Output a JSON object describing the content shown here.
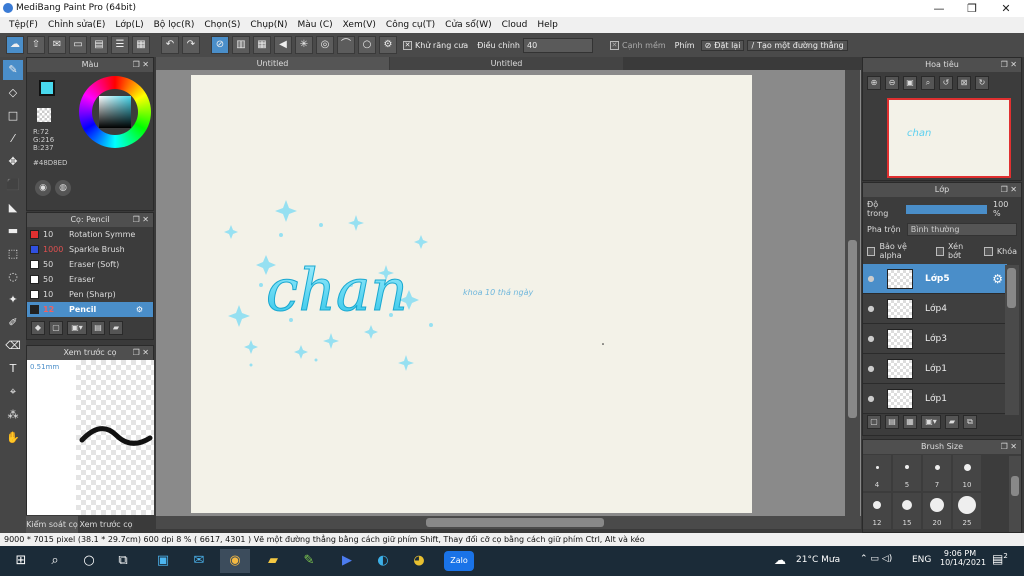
{
  "window": {
    "title": "MediBang Paint Pro (64bit)",
    "min": "—",
    "max": "❐",
    "close": "✕"
  },
  "menu": [
    "Tệp(F)",
    "Chỉnh sửa(E)",
    "Lớp(L)",
    "Bộ lọc(R)",
    "Chọn(S)",
    "Chụp(N)",
    "Màu (C)",
    "Xem(V)",
    "Công cụ(T)",
    "Cửa sổ(W)",
    "Cloud",
    "Help"
  ],
  "toolbar": {
    "antialias_label": "Khử răng cưa",
    "adjust_label": "Điều chỉnh",
    "adjust_value": "40",
    "edge_label": "Cạnh mềm",
    "key_label": "Phím",
    "set_label": "Đặt lại",
    "straight_label": "Tạo một đường thẳng"
  },
  "tabs": [
    "Untitled",
    "Untitled"
  ],
  "color_panel": {
    "title": "Màu",
    "r": "R:72",
    "g": "G:216",
    "b": "B:237",
    "hex": "#48D8ED",
    "primary": "#48D8ED",
    "secondary": "#FF0000"
  },
  "brush_panel": {
    "title": "Cọ: Pencil",
    "items": [
      {
        "size": "10",
        "name": "Rotation Symme",
        "color": "#e03030"
      },
      {
        "size": "1000",
        "name": "Sparkle Brush",
        "color": "#3050e0"
      },
      {
        "size": "50",
        "name": "Eraser (Soft)",
        "color": "#ffffff"
      },
      {
        "size": "50",
        "name": "Eraser",
        "color": "#ffffff"
      },
      {
        "size": "10",
        "name": "Pen (Sharp)",
        "color": "#ffffff"
      },
      {
        "size": "12",
        "name": "Pencil",
        "color": "#222222"
      }
    ]
  },
  "preview_panel": {
    "title": "Xem trước cọ",
    "size": "0.51mm"
  },
  "bottom_tabs": [
    "Kiểm soát cọ",
    "Xem trước cọ"
  ],
  "canvas_art": {
    "main_text": "chan",
    "small_text": "khoa 10 thá ngày"
  },
  "navigator": {
    "title": "Hoa tiêu"
  },
  "layer_panel": {
    "title": "Lớp",
    "opacity_label": "Độ trong",
    "opacity_value": "100 %",
    "opacity_fraction": 1.0,
    "blend_label": "Pha trộn",
    "blend_value": "Bình thường",
    "protect_alpha": "Bảo vệ alpha",
    "clipping": "Xén bớt",
    "lock": "Khóa",
    "layers": [
      "Lớp5",
      "Lớp4",
      "Lớp3",
      "Lớp1",
      "Lớp1"
    ]
  },
  "brush_size_panel": {
    "title": "Brush Size",
    "sizes": [
      "4",
      "5",
      "7",
      "10",
      "12",
      "15",
      "20",
      "25"
    ]
  },
  "status": {
    "text": "9000 * 7015 pixel   (38.1 * 29.7cm)   600 dpi   8 %   ( 6617, 4301 )   Vẽ một đường thẳng bằng cách giữ phím Shift, Thay đổi cỡ cọ bằng cách giữ phím Ctrl, Alt và kéo"
  },
  "taskbar": {
    "weather": "21°C Mưa",
    "lang": "ENG",
    "time": "9:06 PM",
    "date": "10/14/2021",
    "notif": "2"
  }
}
